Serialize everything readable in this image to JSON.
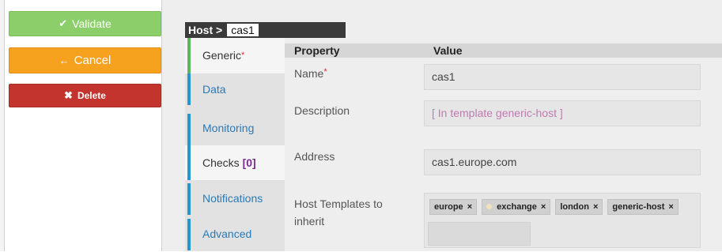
{
  "actions": {
    "validate_label": "Validate",
    "cancel_label": "Cancel",
    "delete_label": "Delete",
    "validate_icon": "check-icon",
    "cancel_icon": "arrow-left-icon",
    "delete_icon": "times-icon"
  },
  "breadcrumb": {
    "prefix": "Host >",
    "host_name": "cas1"
  },
  "tabs": [
    {
      "label": "Generic",
      "required_mark": "*"
    },
    {
      "label": "Data"
    },
    {
      "label": "Monitoring"
    },
    {
      "label": "Checks",
      "count": "[0]"
    },
    {
      "label": "Notifications"
    },
    {
      "label": "Advanced"
    }
  ],
  "table": {
    "col_property": "Property",
    "col_value": "Value"
  },
  "fields": {
    "name_label": "Name",
    "name_required": "*",
    "name_value": "cas1",
    "description_label": "Description",
    "description_placeholder": "[ In template generic-host ]",
    "address_label": "Address",
    "address_value": "cas1.europe.com",
    "templates_label": "Host Templates to inherit"
  },
  "templates": [
    {
      "label": "europe",
      "remove": "×"
    },
    {
      "label": "exchange",
      "remove": "×"
    },
    {
      "label": "london",
      "remove": "×"
    },
    {
      "label": "generic-host",
      "remove": "×"
    }
  ],
  "colors": {
    "validate": "#8ccf6a",
    "cancel": "#f6a21e",
    "delete": "#c4342e",
    "tab_link": "#2a7ab5",
    "active_tab_marker": "#5cb85c"
  }
}
